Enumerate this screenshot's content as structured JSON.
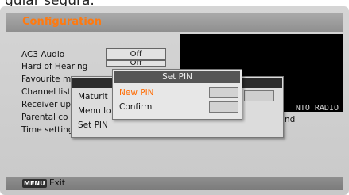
{
  "top_partial_text": "guiar segura.",
  "header": {
    "title": "Configuration"
  },
  "settings": [
    {
      "label": "AC3 Audio",
      "value": "Off"
    },
    {
      "label": "Hard of Hearing",
      "value": "Off"
    },
    {
      "label": "Favourite m"
    },
    {
      "label": "Channel list"
    },
    {
      "label": "Receiver up"
    },
    {
      "label": "Parental co"
    },
    {
      "label": "Time setting"
    }
  ],
  "preview": {
    "label": "NTO RADIO",
    "right_text": "nd"
  },
  "background_dialog": {
    "items": [
      {
        "label": "Maturit"
      },
      {
        "label": "Menu lo"
      },
      {
        "label": "Set PIN"
      }
    ]
  },
  "set_pin_dialog": {
    "title": "Set PIN",
    "new_pin_label": "New PIN",
    "confirm_label": "Confirm",
    "active_color": "#ff6a00"
  },
  "footer": {
    "menu_key": "MENU",
    "exit_label": "Exit"
  }
}
